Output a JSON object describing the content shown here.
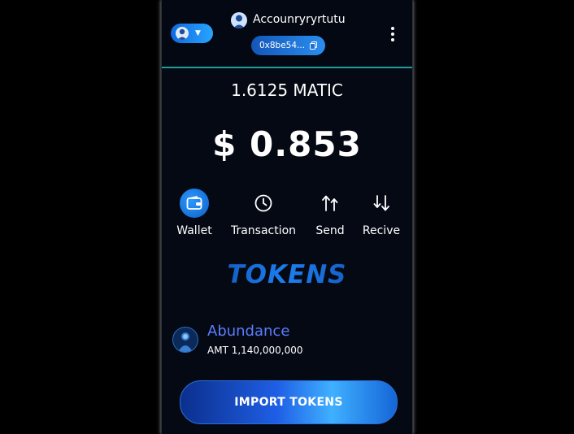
{
  "header": {
    "account_name": "Accounryryrtutu",
    "address_short": "0x8be54...",
    "network_icon": "user-avatar-icon",
    "menu_icon": "kebab-menu-icon"
  },
  "balance": {
    "native": "1.6125 MATIC",
    "usd": "$ 0.853"
  },
  "actions": [
    {
      "label": "Wallet",
      "icon": "wallet-icon"
    },
    {
      "label": "Transaction",
      "icon": "clock-icon"
    },
    {
      "label": "Send",
      "icon": "send-arrows-icon"
    },
    {
      "label": "Recive",
      "icon": "receive-arrows-icon"
    }
  ],
  "tokens_title": "TOKENS",
  "tokens": [
    {
      "name": "Abundance",
      "amount": "AMT 1,140,000,000"
    }
  ],
  "import_button": "IMPORT TOKENS",
  "colors": {
    "accent": "#1f7fff",
    "divider": "#1f9c9a",
    "token_name": "#5a7dff"
  }
}
